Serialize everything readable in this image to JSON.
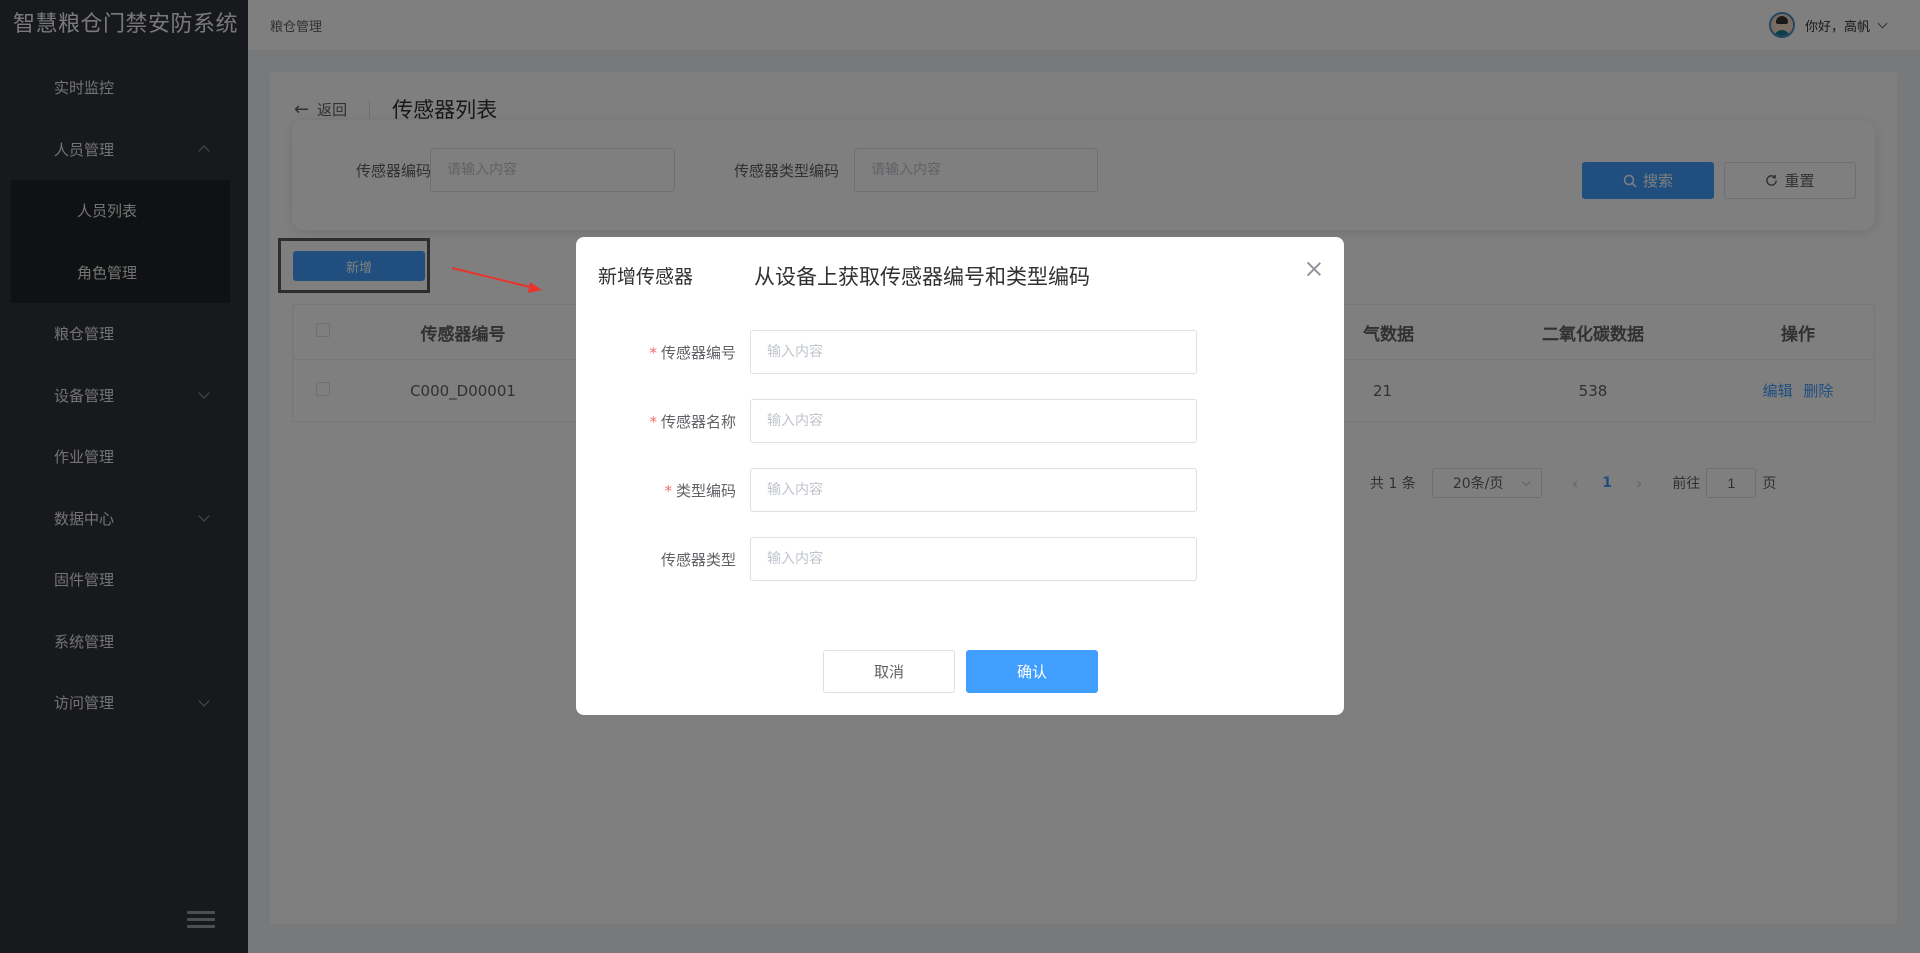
{
  "app": {
    "title": "智慧粮仓门禁安防系统"
  },
  "sidebar": {
    "items": [
      {
        "label": "实时监控"
      },
      {
        "label": "人员管理"
      },
      {
        "label": "人员列表"
      },
      {
        "label": "角色管理"
      },
      {
        "label": "粮仓管理"
      },
      {
        "label": "设备管理"
      },
      {
        "label": "作业管理"
      },
      {
        "label": "数据中心"
      },
      {
        "label": "固件管理"
      },
      {
        "label": "系统管理"
      },
      {
        "label": "访问管理"
      }
    ]
  },
  "header": {
    "breadcrumb": "粮仓管理",
    "greeting": "你好，高帆"
  },
  "page": {
    "back_label": "返回",
    "title": "传感器列表"
  },
  "search": {
    "code_label": "传感器编码",
    "code_placeholder": "请输入内容",
    "type_label": "传感器类型编码",
    "type_placeholder": "请输入内容",
    "search_btn": "搜索",
    "reset_btn": "重置"
  },
  "toolbar": {
    "add_btn": "新增"
  },
  "table": {
    "columns": {
      "code": "传感器编号",
      "oxygen": "气数据",
      "co2": "二氧化碳数据",
      "ops": "操作"
    },
    "rows": [
      {
        "code": "C000_D00001",
        "oxygen": "21",
        "co2": "538",
        "edit": "编辑",
        "delete": "删除"
      }
    ]
  },
  "pagination": {
    "total": "共 1 条",
    "page_size": "20条/页",
    "current": "1",
    "goto_prefix": "前往",
    "goto_value": "1",
    "goto_suffix": "页"
  },
  "dialog": {
    "title": "新增传感器",
    "hint": "从设备上获取传感器编号和类型编码",
    "fields": [
      {
        "label": "传感器编号",
        "required": "*",
        "placeholder": "输入内容"
      },
      {
        "label": "传感器名称",
        "required": "*",
        "placeholder": "输入内容"
      },
      {
        "label": "类型编码",
        "required": "*",
        "placeholder": "输入内容"
      },
      {
        "label": "传感器类型",
        "placeholder": "输入内容"
      }
    ],
    "cancel": "取消",
    "confirm": "确认"
  },
  "colors": {
    "primary": "#409eff",
    "sidebar_bg": "#2e3238",
    "danger": "#f56c6c",
    "annotation": "#e8342c"
  }
}
